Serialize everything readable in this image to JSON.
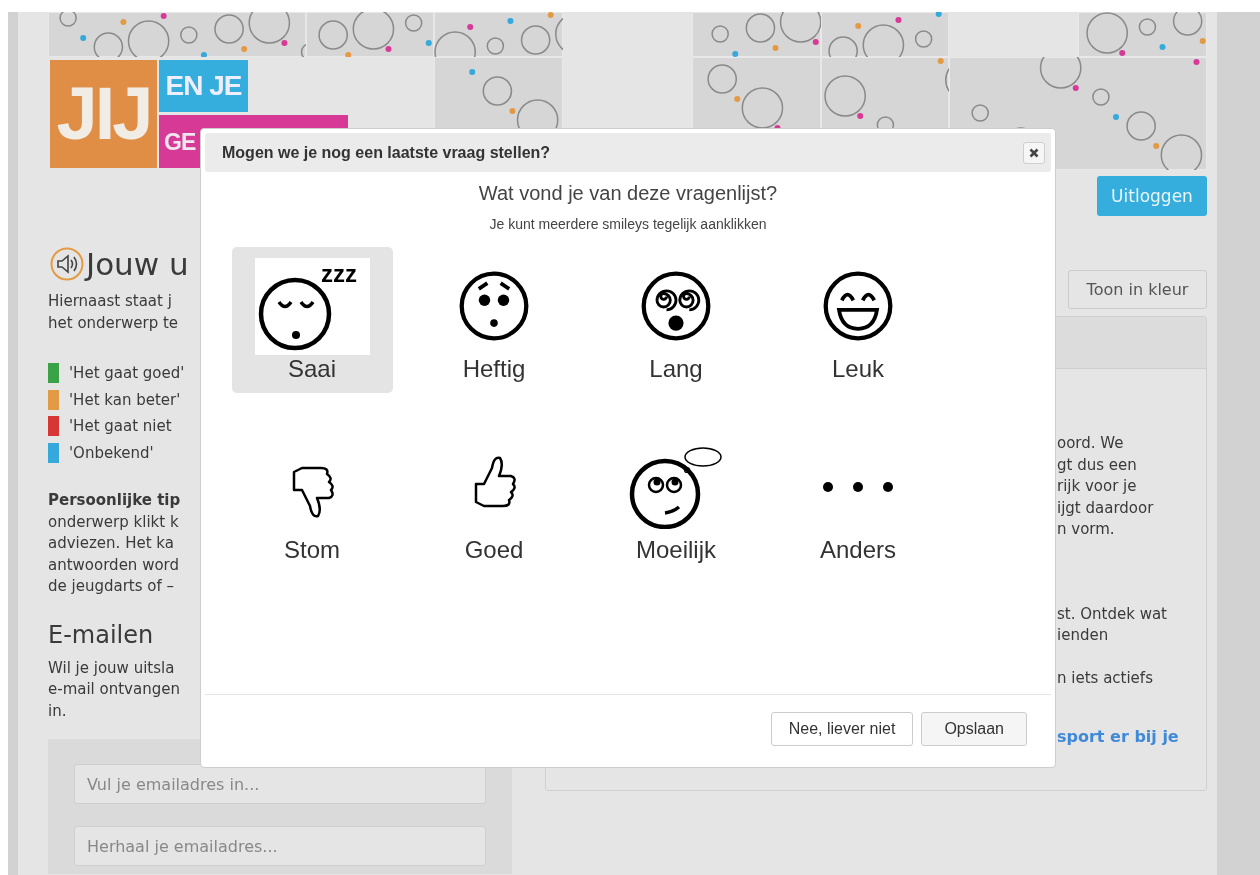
{
  "header": {
    "logo": {
      "word_1": "JIJ",
      "word_2": "EN JE",
      "word_3": "GE"
    }
  },
  "logout_button": "Uitloggen",
  "results": {
    "title": "Jouw u",
    "intro": [
      "Hiernaast staat j",
      "het onderwerp te"
    ],
    "legend": [
      {
        "label": "'Het gaat goed'",
        "color": "#3aa348"
      },
      {
        "label": "'Het kan beter'",
        "color": "#e39a44"
      },
      {
        "label": "'Het gaat niet",
        "color": "#d83535"
      },
      {
        "label": "'Onbekend'",
        "color": "#36a9dc"
      }
    ],
    "tips": [
      "**Persoonlijke tip**",
      "onderwerp klikt k",
      "adviezen. Het ka",
      "antwoorden word",
      "de jeugdarts of –"
    ]
  },
  "email": {
    "title": "E-mailen",
    "lines": [
      "Wil je jouw uitsla",
      "e-mail ontvangen",
      "in."
    ],
    "fields": [
      {
        "placeholder": "Vul je emailadres in..."
      },
      {
        "placeholder": "Herhaal je emailadres..."
      }
    ]
  },
  "color_button": "Toon in kleur",
  "info_panel": {
    "paragraphs": [
      [
        "oord. We",
        "gt dus een",
        "rijk voor je",
        "ijgt daardoor",
        "n vorm."
      ],
      [
        "st. Ontdek wat",
        "ienden"
      ],
      [
        "n iets actiefs"
      ]
    ],
    "link": "sport er bij je"
  },
  "dialog": {
    "title": "Mogen we je nog een laatste vraag stellen?",
    "question": "Wat vond je van deze vragenlijst?",
    "hint": "Je kunt meerdere smileys tegelijk aanklikken",
    "options": [
      {
        "label": "Saai",
        "selected": true,
        "icon_text": "zzz"
      },
      {
        "label": "Heftig",
        "selected": false
      },
      {
        "label": "Lang",
        "selected": false
      },
      {
        "label": "Leuk",
        "selected": false
      },
      {
        "label": "Stom",
        "selected": false
      },
      {
        "label": "Goed",
        "selected": false
      },
      {
        "label": "Moeilijk",
        "selected": false
      },
      {
        "label": "Anders",
        "selected": false
      }
    ],
    "buttons": [
      {
        "label": "Nee, liever niet",
        "kind": "secondary"
      },
      {
        "label": "Opslaan",
        "kind": "primary"
      }
    ]
  }
}
